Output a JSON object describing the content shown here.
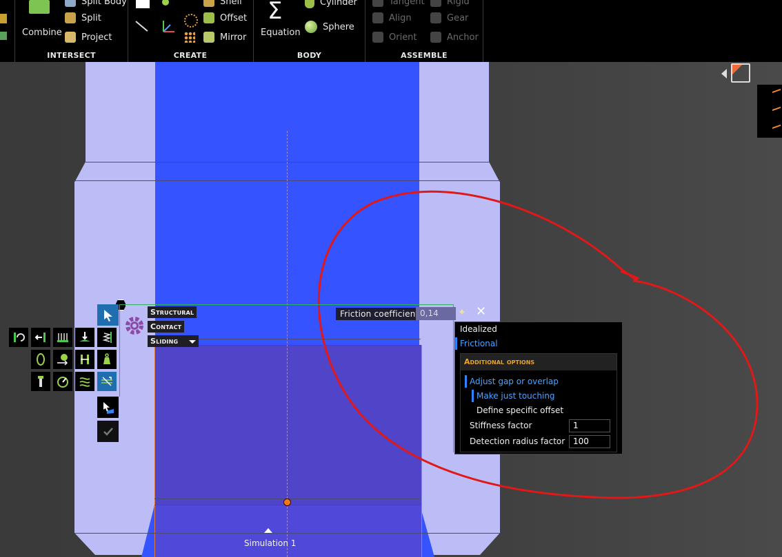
{
  "ribbon": {
    "intersect": {
      "title": "Intersect",
      "combine": "Combine",
      "split_body": "Split Body",
      "split": "Split",
      "project": "Project"
    },
    "create": {
      "title": "Create",
      "shell": "Shell",
      "offset": "Offset",
      "mirror": "Mirror"
    },
    "body": {
      "title": "Body",
      "equation": "Equation",
      "cylinder": "Cylinder",
      "sphere": "Sphere"
    },
    "assemble": {
      "title": "Assemble",
      "tangent": "Tangent",
      "rigid": "Rigid",
      "align": "Align",
      "gear": "Gear",
      "orient": "Orient",
      "anchor": "Anchor"
    }
  },
  "contact": {
    "line1": "Structural",
    "line2": "Contact",
    "mode": "Sliding"
  },
  "friction": {
    "label": "Friction coefficient",
    "value": "0,14"
  },
  "options": {
    "idealized": "Idealized",
    "frictional": "Frictional",
    "additional_title": "Additional options",
    "adjust_gap": "Adjust gap or overlap",
    "make_touching": "Make just touching",
    "define_offset": "Define specific offset",
    "stiffness_label": "Stiffness factor",
    "stiffness_value": "1",
    "detection_label": "Detection radius factor",
    "detection_value": "100"
  },
  "simulation": {
    "label": "Simulation 1"
  },
  "colors": {
    "accent_blue": "#2e86ff",
    "body_light": "#bcbcf6",
    "body_blue": "#3553ff",
    "annotation_red": "#e01818",
    "options_header": "#e8a32a"
  }
}
